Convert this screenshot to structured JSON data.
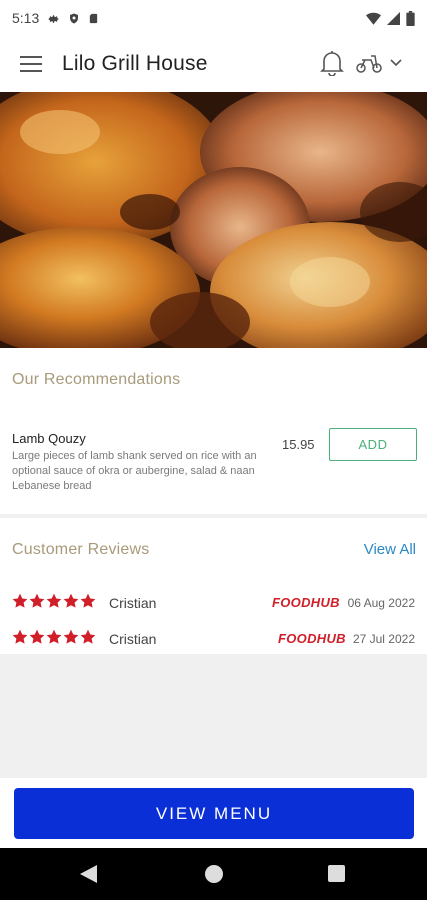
{
  "status_bar": {
    "time": "5:13"
  },
  "app_bar": {
    "title": "Lilo Grill House"
  },
  "recommendations": {
    "title": "Our Recommendations",
    "items": [
      {
        "name": "Lamb Qouzy",
        "description": "Large pieces of lamb shank served on rice with an optional sauce of okra or aubergine, salad & naan Lebanese bread",
        "price": "15.95",
        "add_label": "ADD"
      }
    ]
  },
  "reviews": {
    "title": "Customer Reviews",
    "view_all": "View All",
    "items": [
      {
        "rating": 5,
        "reviewer": "Cristian",
        "source": "FOODHUB",
        "date": "06 Aug 2022"
      },
      {
        "rating": 5,
        "reviewer": "Cristian",
        "source": "FOODHUB",
        "date": "27 Jul 2022"
      }
    ]
  },
  "bottom": {
    "view_menu_label": "VIEW MENU"
  },
  "colors": {
    "accent_blue": "#0a2fd6",
    "star_red": "#d11f2a",
    "add_green": "#4caf7a",
    "section_title": "#a89a7a",
    "link_blue": "#2a88c8"
  }
}
